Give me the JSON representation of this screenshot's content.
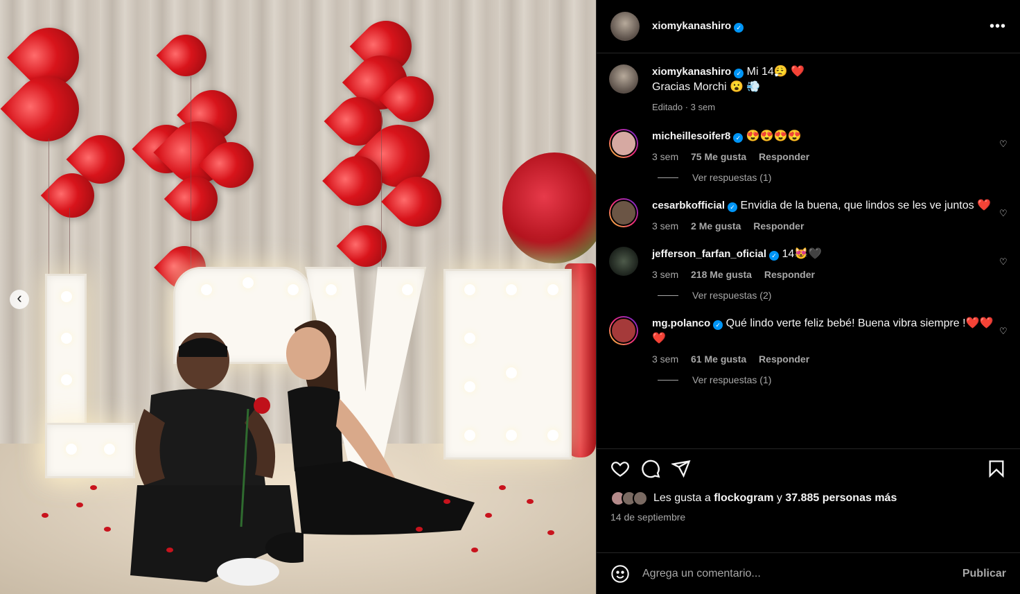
{
  "post": {
    "author": "xiomykanashiro",
    "caption_line1": "Mi 14😮‍💨 ❤️",
    "caption_line2": "Gracias Morchi 😮 💨",
    "caption_meta": "Editado · 3 sem"
  },
  "comments": [
    {
      "user": "micheillesoifer8",
      "text": "😍😍😍😍",
      "time": "3 sem",
      "likes": "75 Me gusta",
      "reply": "Responder",
      "replies": "Ver respuestas (1)"
    },
    {
      "user": "cesarbkofficial",
      "text": "Envidia de la buena, que lindos se les ve juntos ❤️",
      "time": "3 sem",
      "likes": "2 Me gusta",
      "reply": "Responder"
    },
    {
      "user": "jefferson_farfan_oficial",
      "text": "14😻🖤",
      "time": "3 sem",
      "likes": "218 Me gusta",
      "reply": "Responder",
      "replies": "Ver respuestas (2)"
    },
    {
      "user": "mg.polanco",
      "text": "Qué lindo verte feliz bebé! Buena vibra siempre !❤️❤️❤️",
      "time": "3 sem",
      "likes": "61 Me gusta",
      "reply": "Responder",
      "replies": "Ver respuestas (1)"
    }
  ],
  "likes": {
    "prefix": "Les gusta a ",
    "first_user": "flockogram",
    "middle": " y ",
    "count": "37.885 personas más"
  },
  "date": "14 de septiembre",
  "add_comment": {
    "placeholder": "Agrega un comentario...",
    "publish": "Publicar"
  },
  "photo": {
    "sign_text": "LOVE"
  },
  "colors": {
    "background": "#000000",
    "verified": "#0095f6",
    "muted": "#a8a8a8",
    "balloon": "#d8141b"
  },
  "icons": [
    "more-icon",
    "heart-icon",
    "comment-icon",
    "share-icon",
    "save-icon",
    "emoji-icon",
    "carousel-prev-icon",
    "verified-icon"
  ]
}
